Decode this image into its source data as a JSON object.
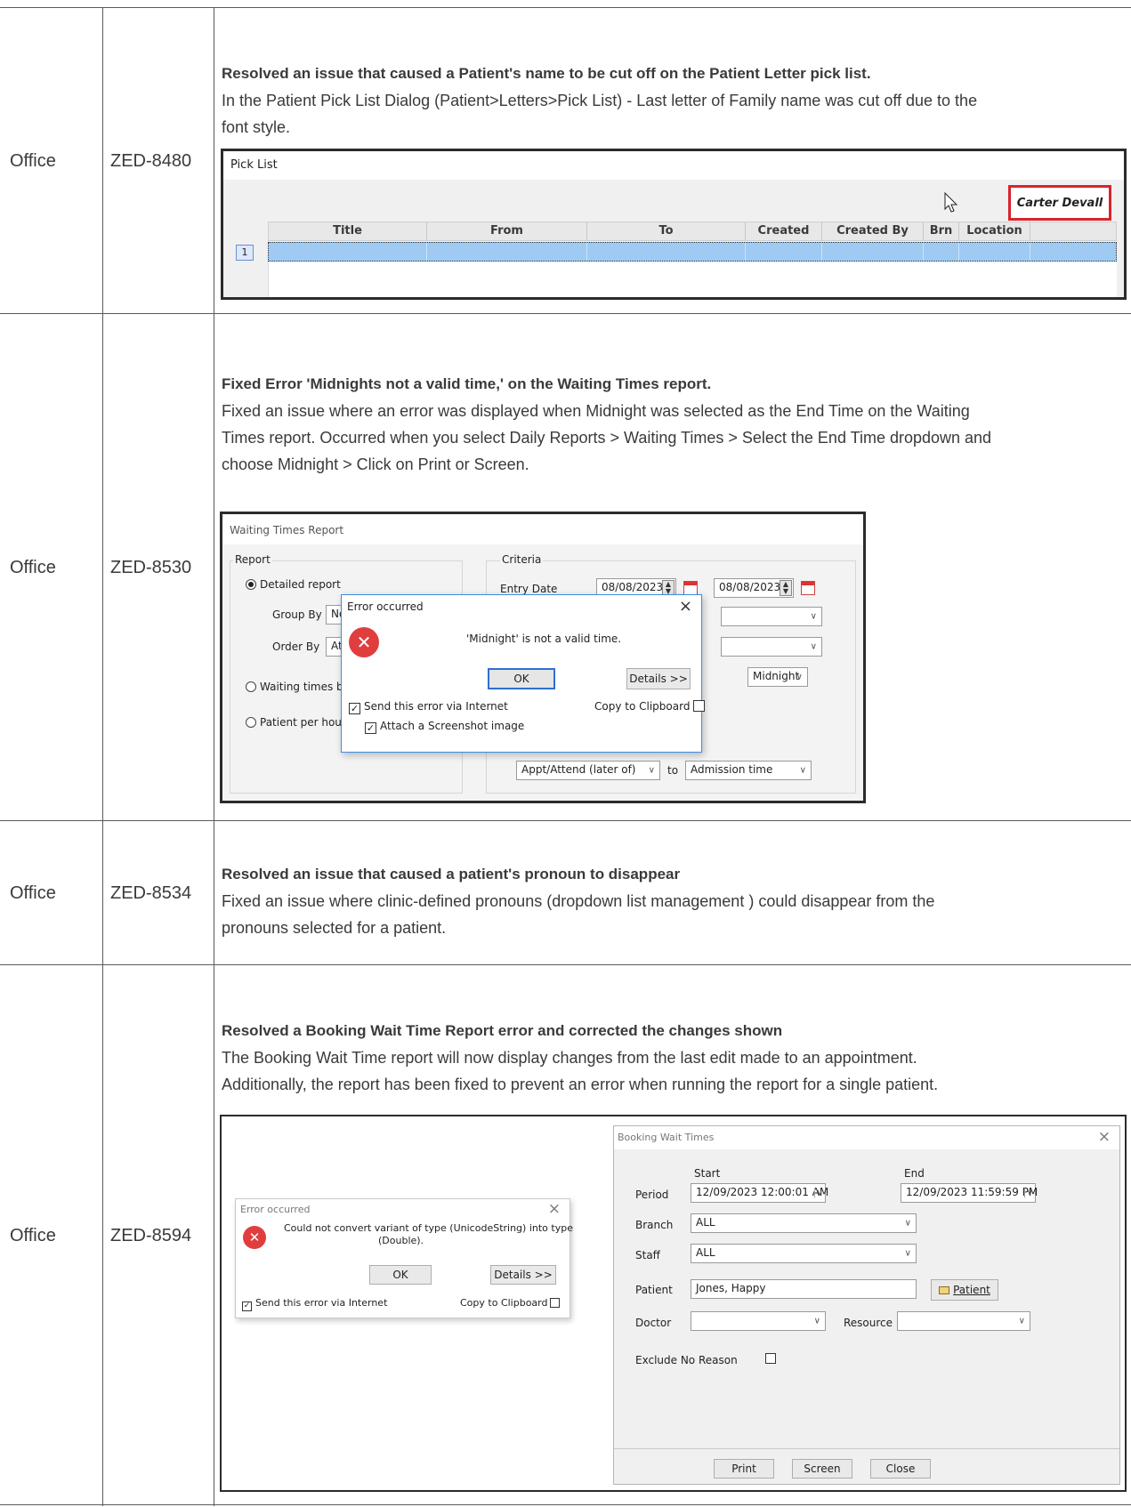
{
  "rows": [
    {
      "module": "Office",
      "id": "ZED-8480",
      "title": "Resolved an issue that caused a Patient's name to be cut off on the Patient Letter pick list.",
      "body": [
        "In the Patient Pick List Dialog (Patient>Letters>Pick List) - Last letter of Family name was cut off due to the",
        "font style."
      ]
    },
    {
      "module": "Office",
      "id": "ZED-8530",
      "title": "Fixed Error 'Midnights not a valid time,' on the Waiting Times report.",
      "body": [
        "Fixed an issue where an error was displayed when Midnight was selected as the End Time on the Waiting",
        "Times report. Occurred when you select Daily Reports > Waiting Times > Select the End Time dropdown and",
        "choose Midnight > Click on Print or Screen."
      ]
    },
    {
      "module": "Office",
      "id": "ZED-8534",
      "title": "Resolved an issue that caused a patient's pronoun to disappear",
      "body": [
        "Fixed an issue where clinic-defined pronouns (dropdown list management ) could disappear from the",
        "pronouns selected for a patient."
      ]
    },
    {
      "module": "Office",
      "id": "ZED-8594",
      "title": "Resolved a Booking Wait Time Report error and corrected the changes shown",
      "body": [
        "The Booking Wait Time report will now display changes from the last edit made to an appointment.",
        "Additionally, the report has been fixed to prevent an error when running the report for a single patient."
      ]
    }
  ],
  "picklist": {
    "title": "Pick List",
    "patient_name": "Carter Devall",
    "columns": [
      "Title",
      "From",
      "To",
      "Created",
      "Created By",
      "Brn",
      "Location"
    ],
    "row_number": "1"
  },
  "waiting": {
    "window_title": "Waiting Times Report",
    "report_group": "Report",
    "criteria_group": "Criteria",
    "detailed": "Detailed report",
    "group_by": "Group By",
    "group_by_value": "Non",
    "order_by": "Order By",
    "order_by_value": "Atte",
    "waiting_by": "Waiting times by H",
    "patient_per_hour": "Patient per hour b",
    "entry_date": "Entry Date",
    "date_from": "08/08/2023",
    "date_to": "08/08/2023",
    "end_time": "Midnight",
    "appt_attend": "Appt/Attend (later of)",
    "to": "to",
    "admission": "Admission time",
    "error_title": "Error occurred",
    "error_msg": "'Midnight' is not a valid time.",
    "ok": "OK",
    "details": "Details >>",
    "send_error": "Send this error via Internet",
    "copy_clip": "Copy to Clipboard",
    "attach": "Attach a Screenshot image",
    "close": "×"
  },
  "booking": {
    "error_title": "Error occurred",
    "error_msg_1": "Could not convert variant of type (UnicodeString) into type",
    "error_msg_2": "(Double).",
    "ok": "OK",
    "details": "Details >>",
    "send_error": "Send this error via Internet",
    "copy_clip": "Copy to Clipboard",
    "window_title": "Booking Wait Times",
    "start": "Start",
    "end": "End",
    "period": "Period",
    "start_value": "12/09/2023 12:00:01 AM",
    "end_value": "12/09/2023 11:59:59 PM",
    "branch": "Branch",
    "branch_value": "ALL",
    "staff": "Staff",
    "staff_value": "ALL",
    "patient": "Patient",
    "patient_value": "Jones, Happy",
    "patient_btn": "Patient",
    "doctor": "Doctor",
    "resource": "Resource",
    "exclude": "Exclude No Reason",
    "print": "Print",
    "screen": "Screen",
    "close_btn": "Close",
    "close": "×"
  }
}
